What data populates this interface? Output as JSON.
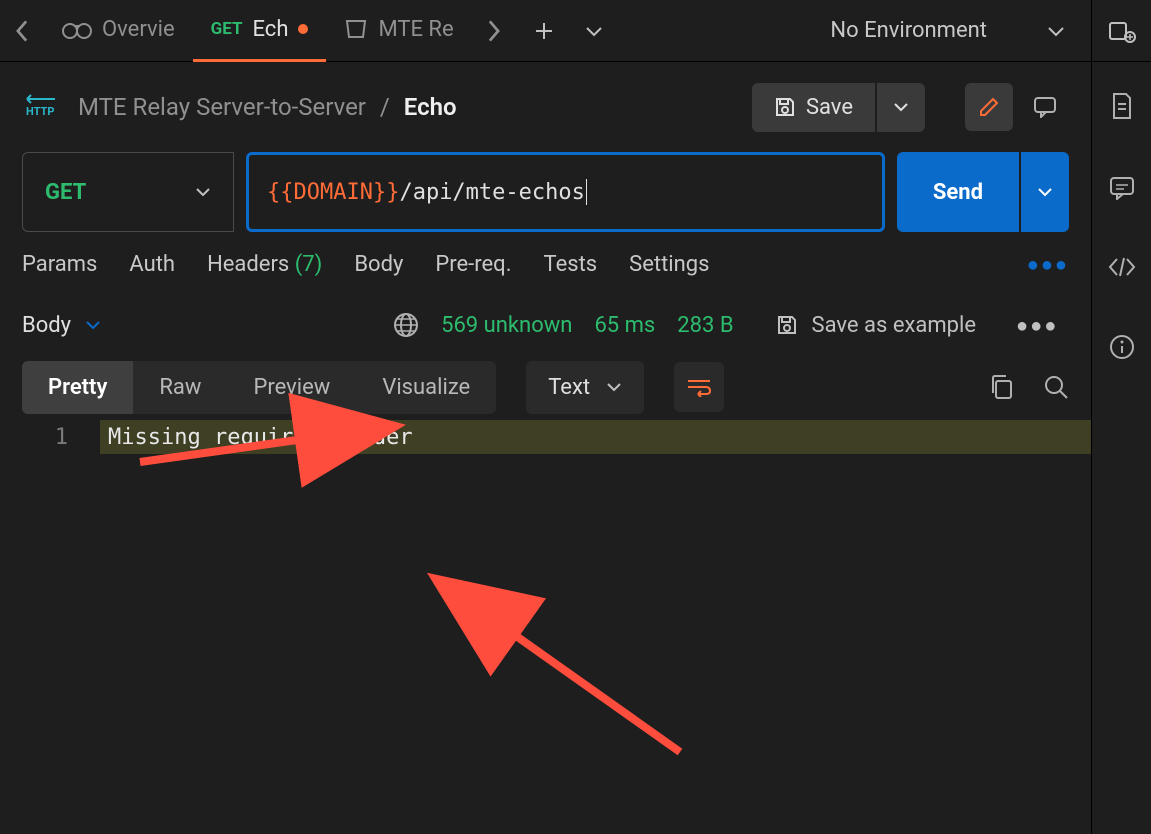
{
  "top": {
    "tabs": [
      {
        "label": "Overvie"
      },
      {
        "method": "GET",
        "label": "Ech",
        "modified": true
      },
      {
        "label": "MTE Re"
      }
    ],
    "environment": "No Environment"
  },
  "breadcrumb": {
    "collection": "MTE Relay Server-to-Server",
    "request": "Echo",
    "save_label": "Save"
  },
  "request": {
    "method": "GET",
    "url_variable": "{{DOMAIN}}",
    "url_path": "/api/mte-echos",
    "send_label": "Send",
    "tabs": {
      "params": "Params",
      "auth": "Auth",
      "headers": "Headers",
      "headers_count": "(7)",
      "body": "Body",
      "prereq": "Pre-req.",
      "tests": "Tests",
      "settings": "Settings"
    }
  },
  "response": {
    "body_label": "Body",
    "status_code": "569 unknown",
    "time": "65 ms",
    "size": "283 B",
    "save_example": "Save as example",
    "view_tabs": {
      "pretty": "Pretty",
      "raw": "Raw",
      "preview": "Preview",
      "visualize": "Visualize"
    },
    "content_type": "Text",
    "line_number": "1",
    "body_text": "Missing required header"
  }
}
